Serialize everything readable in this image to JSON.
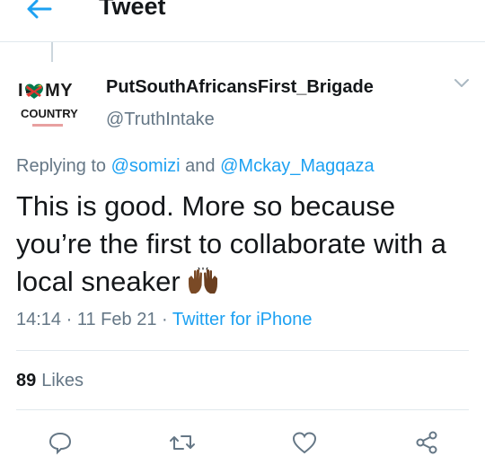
{
  "header": {
    "title": "Tweet",
    "back_icon": "arrow-left-icon"
  },
  "author": {
    "avatar_line1_a": "I",
    "avatar_line1_b": "MY",
    "avatar_line2": "COUNTRY",
    "display_name": "PutSouthAfricansFirst_Brigade",
    "handle": "@TruthIntake"
  },
  "reply": {
    "prefix": "Replying to",
    "mention1": "@somizi",
    "conjunction": "and",
    "mention2": "@Mckay_Magqaza"
  },
  "tweet": {
    "text": "This is good. More so because you’re the first to collaborate with a local sneaker"
  },
  "meta": {
    "time": "14:14",
    "date": "11 Feb 21",
    "separator": "·",
    "source": "Twitter for iPhone"
  },
  "stats": {
    "likes_count": "89",
    "likes_label": "Likes"
  },
  "colors": {
    "accent": "#1da1f2",
    "muted": "#657786",
    "text": "#14171a",
    "border": "#e1e8ed"
  }
}
